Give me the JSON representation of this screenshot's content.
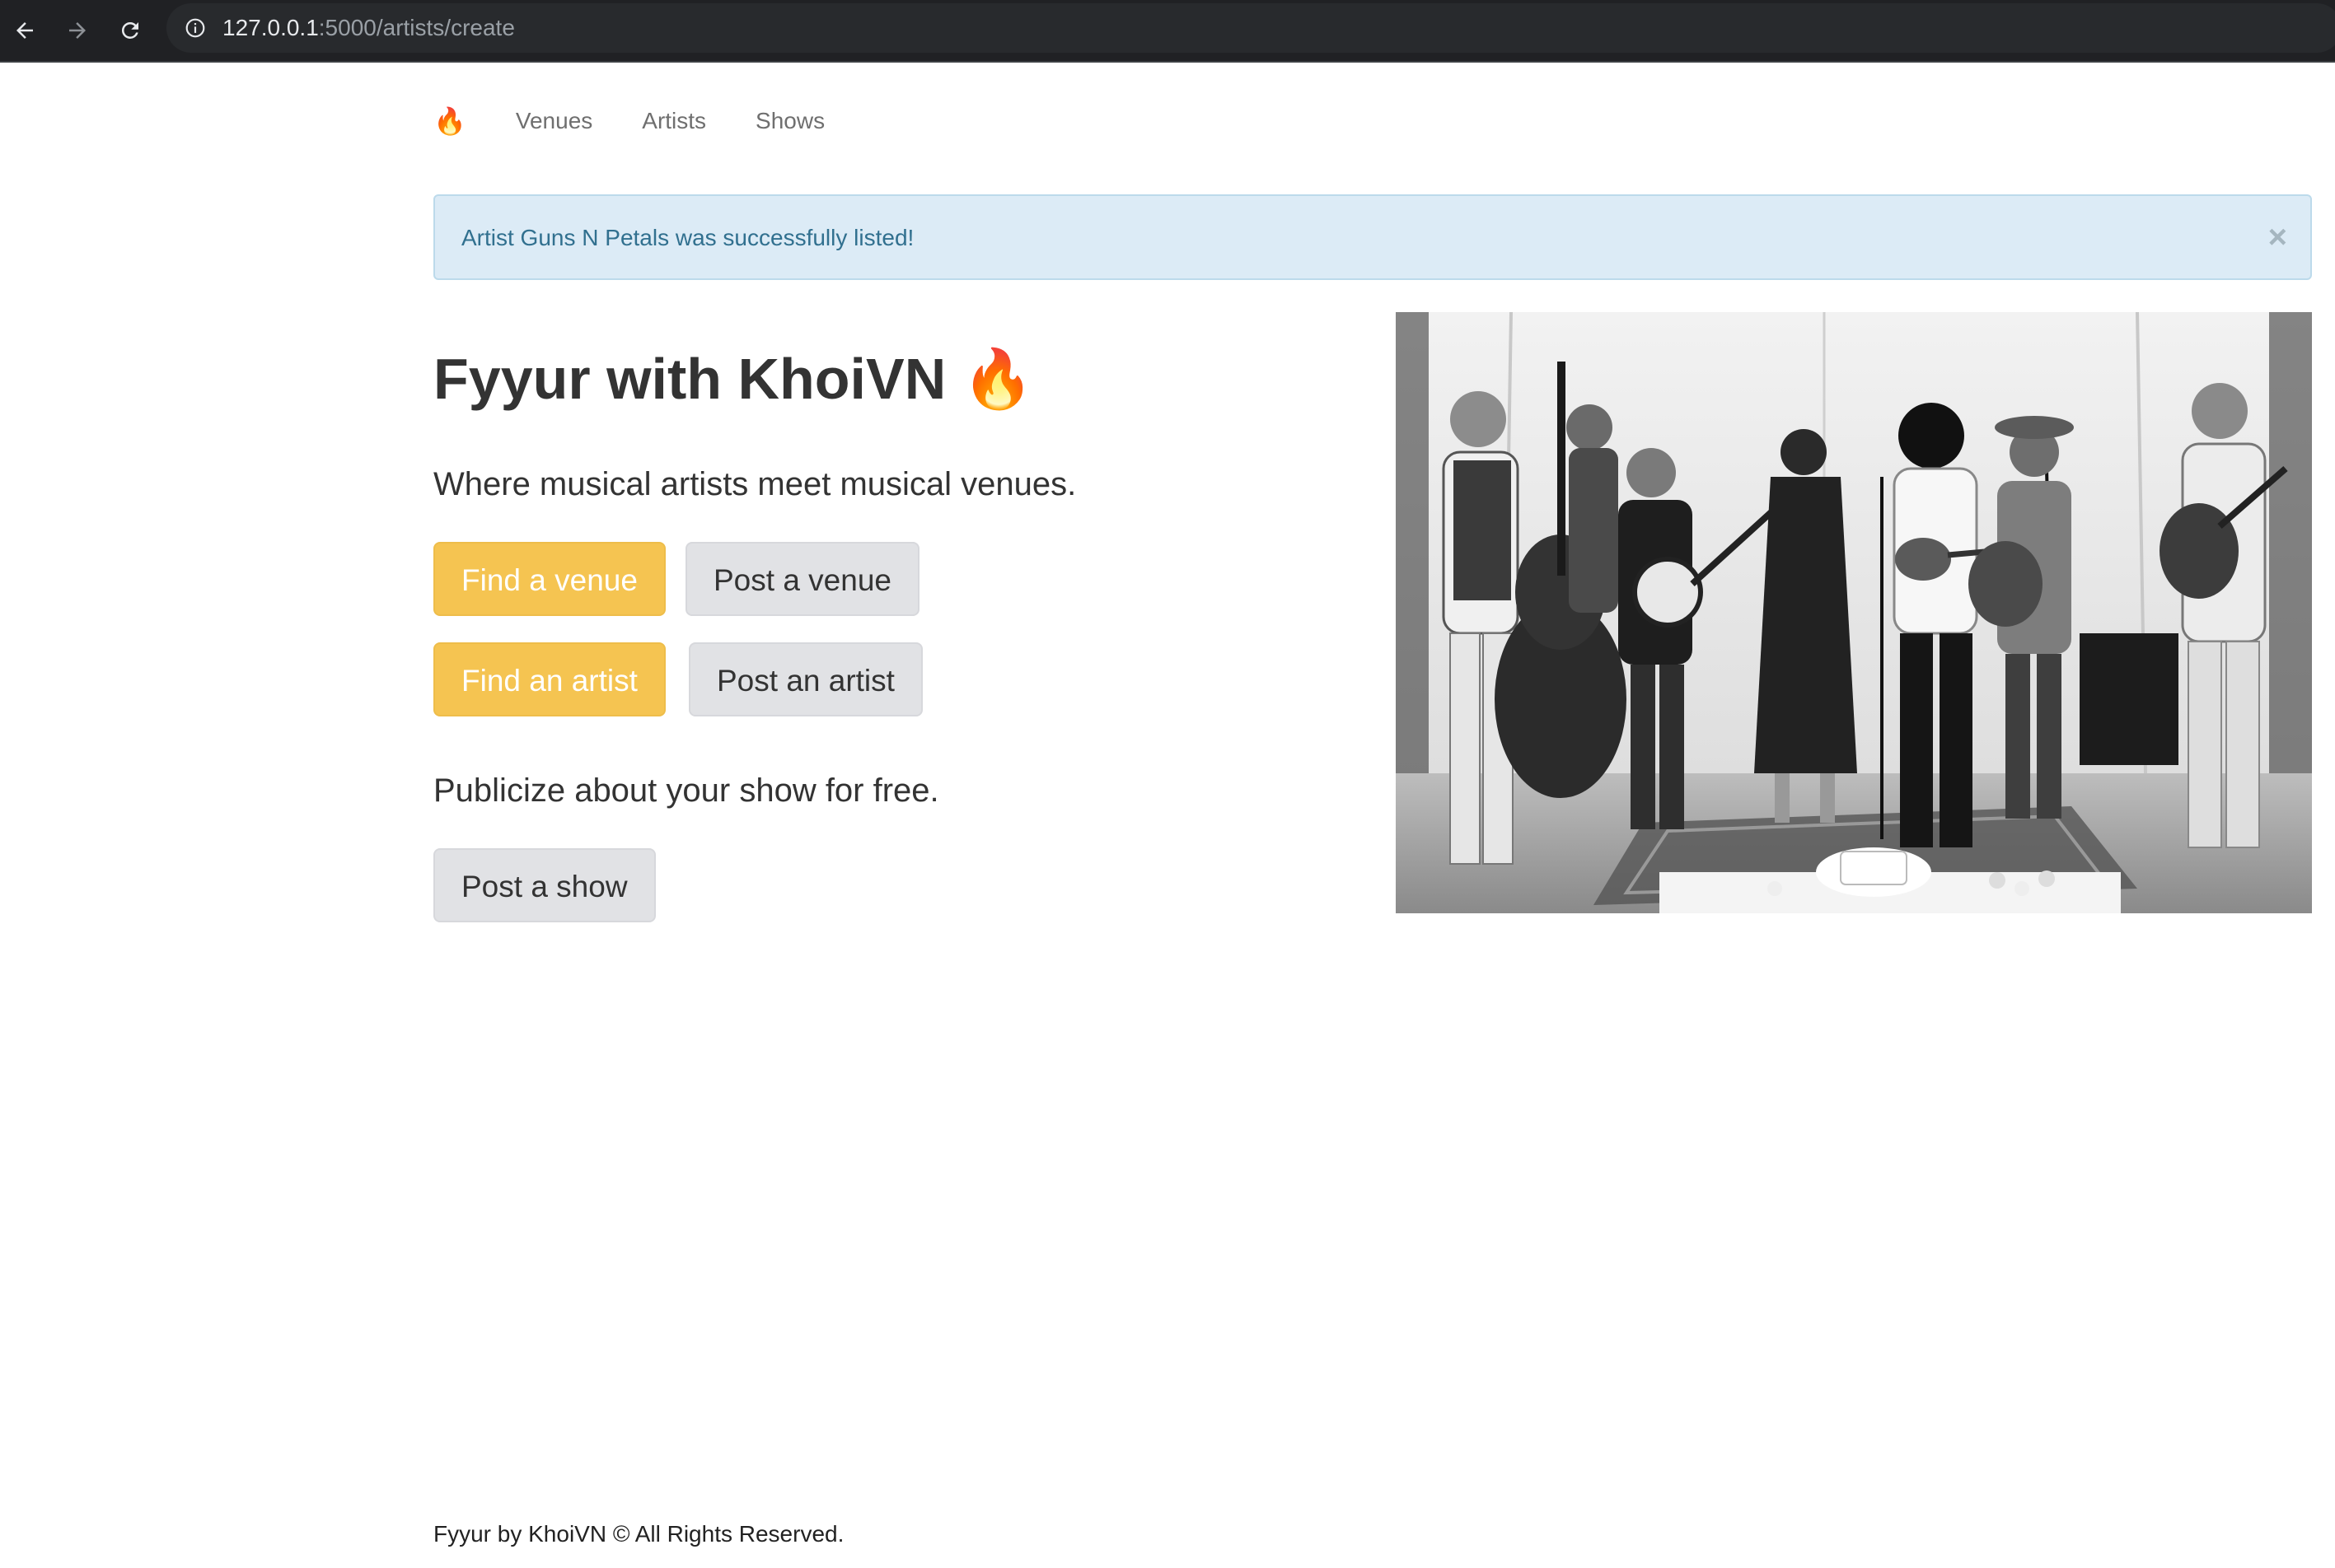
{
  "browser": {
    "url_host": "127.0.0.1",
    "url_path": ":5000/artists/create"
  },
  "nav": {
    "brand": "🔥",
    "links": [
      "Venues",
      "Artists",
      "Shows"
    ]
  },
  "alert": {
    "message": "Artist Guns N Petals was successfully listed!",
    "close": "×"
  },
  "hero": {
    "title": "Fyyur with KhoiVN 🔥",
    "lead": "Where musical artists meet musical venues.",
    "find_venue": "Find a venue",
    "post_venue": "Post a venue",
    "find_artist": "Find an artist",
    "post_artist": "Post an artist",
    "show_lead": "Publicize about your show for free.",
    "post_show": "Post a show"
  },
  "footer": {
    "text": "Fyyur by KhoiVN © All Rights Reserved."
  },
  "colors": {
    "warning": "#f5c451",
    "default_button": "#e1e2e5",
    "alert_bg": "#dcebf6",
    "alert_text": "#31708f"
  },
  "icons": [
    "back-arrow-icon",
    "forward-arrow-icon",
    "reload-icon",
    "info-icon",
    "close-icon",
    "fire-icon"
  ]
}
